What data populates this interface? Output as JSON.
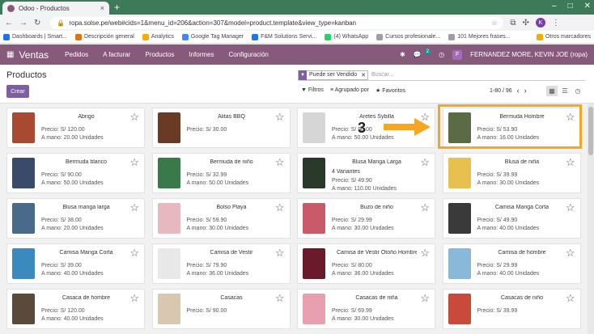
{
  "browser": {
    "tab_title": "Odoo - Productos",
    "url": "ropa.solse.pe/web#cids=1&menu_id=206&action=307&model=product.template&view_type=kanban",
    "profile": "K",
    "bookmarks": [
      "Dashboards | Smart...",
      "Descripción general",
      "Analytics",
      "Google Tag Manager",
      "F&M Solutions Servi...",
      "(4) WhatsApp",
      "Cursos profesionale...",
      "101 Mejores frases..."
    ],
    "other_bookmarks": "Otros marcadores",
    "bookmark_colors": [
      "#1a73e8",
      "#e37400",
      "#f9ab00",
      "#4285f4",
      "#1877f2",
      "#25d366",
      "#9aa0a6",
      "#9aa0a6"
    ]
  },
  "navbar": {
    "app": "Ventas",
    "menus": [
      "Pedidos",
      "A facturar",
      "Productos",
      "Informes",
      "Configuración"
    ],
    "chat_count": "2",
    "user_initial": "F",
    "user": "FERNANDEZ MORE, KEVIN JOE (ropa)",
    "color": "#875a7b"
  },
  "control": {
    "breadcrumb": "Productos",
    "create": "Crear",
    "facet": "Puede ser Vendido",
    "search_placeholder": "Buscar...",
    "filters": "Filtros",
    "group_by": "Agrupado por",
    "favorites": "Favoritos",
    "pager": "1-80 / 96"
  },
  "annotation": {
    "step": "3"
  },
  "products": [
    {
      "name": "Abrigo",
      "price": "Precio: S/ 120.00",
      "onhand": "A mano: 20.00 Unidades",
      "color": "#a84a32"
    },
    {
      "name": "Alitas BBQ",
      "price": "Precio: S/ 30.00",
      "onhand": "",
      "color": "#6b3a24"
    },
    {
      "name": "Aretes Sybilla",
      "price": "Precio: S/ 50.00",
      "onhand": "A mano: 50.00 Unidades",
      "color": "#d6d6d6"
    },
    {
      "name": "Bermuda Hombre",
      "price": "Precio: S/ 53.90",
      "onhand": "A mano: 16.00 Unidades",
      "color": "#5a6b45"
    },
    {
      "name": "Bermuda blanco",
      "price": "Precio: S/ 90.00",
      "onhand": "A mano: 50.00 Unidades",
      "color": "#3a4a6a"
    },
    {
      "name": "Bermuda de niño",
      "price": "Precio: S/ 32.99",
      "onhand": "A mano: 50.00 Unidades",
      "color": "#3a7a4a"
    },
    {
      "name": "Blusa Manga Larga",
      "variants": "4 Variantes",
      "price": "Precio: S/ 49.90",
      "onhand": "A mano: 110.00 Unidades",
      "color": "#2a3a2a"
    },
    {
      "name": "Blusa de niña",
      "price": "Precio: S/ 39.99",
      "onhand": "A mano: 30.00 Unidades",
      "color": "#e8c050"
    },
    {
      "name": "Blusa manga larga",
      "price": "Precio: S/ 38.00",
      "onhand": "A mano: 20.00 Unidades",
      "color": "#4a6a8a"
    },
    {
      "name": "Bolso Playa",
      "price": "Precio: S/ 59.90",
      "onhand": "A mano: 30.00 Unidades",
      "color": "#e8b8c0"
    },
    {
      "name": "Buzo de niño",
      "price": "Precio: S/ 29.99",
      "onhand": "A mano: 30.00 Unidades",
      "color": "#c85a6a"
    },
    {
      "name": "Camisa Manga Corta",
      "price": "Precio: S/ 49.90",
      "onhand": "A mano: 40.00 Unidades",
      "color": "#3a3a3a"
    },
    {
      "name": "Camisa Manga Corta",
      "price": "Precio: S/ 39.00",
      "onhand": "A mano: 40.00 Unidades",
      "color": "#3a8ac0"
    },
    {
      "name": "Camisa de Vestir",
      "price": "Precio: S/ 79.90",
      "onhand": "A mano: 36.00 Unidades",
      "color": "#e8e8e8"
    },
    {
      "name": "Camisa de Vestir Otoño Hombre",
      "price": "Precio: S/ 80.00",
      "onhand": "A mano: 36.00 Unidades",
      "color": "#6a1a2a"
    },
    {
      "name": "Camisa de hombre",
      "price": "Precio: S/ 29.99",
      "onhand": "A mano: 40.00 Unidades",
      "color": "#8ab8d8"
    },
    {
      "name": "Casaca de hombre",
      "price": "Precio: S/ 120.00",
      "onhand": "A mano: 40.00 Unidades",
      "color": "#5a4a3a"
    },
    {
      "name": "Casacas",
      "price": "Precio: S/ 90.00",
      "onhand": "",
      "color": "#d8c8b0"
    },
    {
      "name": "Casacas de niña",
      "price": "Precio: S/ 69.99",
      "onhand": "A mano: 30.00 Unidades",
      "color": "#e8a0b0"
    },
    {
      "name": "Casacas de niño",
      "price": "Precio: S/ 39.99",
      "onhand": "",
      "color": "#c84a3a"
    }
  ]
}
